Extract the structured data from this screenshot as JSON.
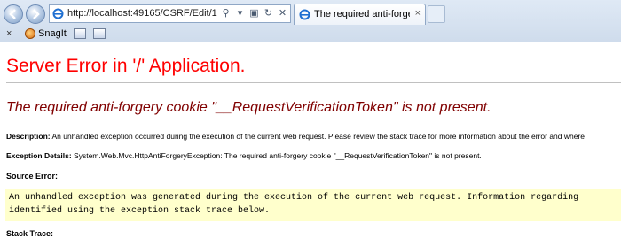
{
  "browser": {
    "address_url": "http://localhost:49165/CSRF/Edit/1",
    "tab_title": "The required anti-forgery c...",
    "tab_close": "×",
    "toolbar": {
      "close_glyph": "×",
      "snagit_label": "SnagIt"
    },
    "icons": [
      "back-arrow-icon",
      "forward-arrow-icon",
      "ie-page-icon",
      "search-icon",
      "dropdown-icon",
      "compat-icon",
      "refresh-icon",
      "stop-icon",
      "new-tab-icon",
      "snagit-icon",
      "toolbar-icon-1",
      "toolbar-icon-2"
    ]
  },
  "page": {
    "title": "Server Error in '/' Application.",
    "error_message": "The required anti-forgery cookie \"__RequestVerificationToken\" is not present.",
    "description_label": "Description:",
    "description_text": " An unhandled exception occurred during the execution of the current web request. Please review the stack trace for more information about the error and where",
    "exception_label": "Exception Details:",
    "exception_text": " System.Web.Mvc.HttpAntiForgeryException: The required anti-forgery cookie \"__RequestVerificationToken\" is not present.",
    "source_error_label": "Source Error:",
    "source_error_lines": [
      "An unhandled exception was generated during the execution of the current web request. Information regarding",
      "identified using the exception stack trace below."
    ],
    "stack_trace_label": "Stack Trace:"
  },
  "colors": {
    "title_red": "#ff0000",
    "error_maroon": "#800000",
    "code_background": "#ffffcc"
  }
}
